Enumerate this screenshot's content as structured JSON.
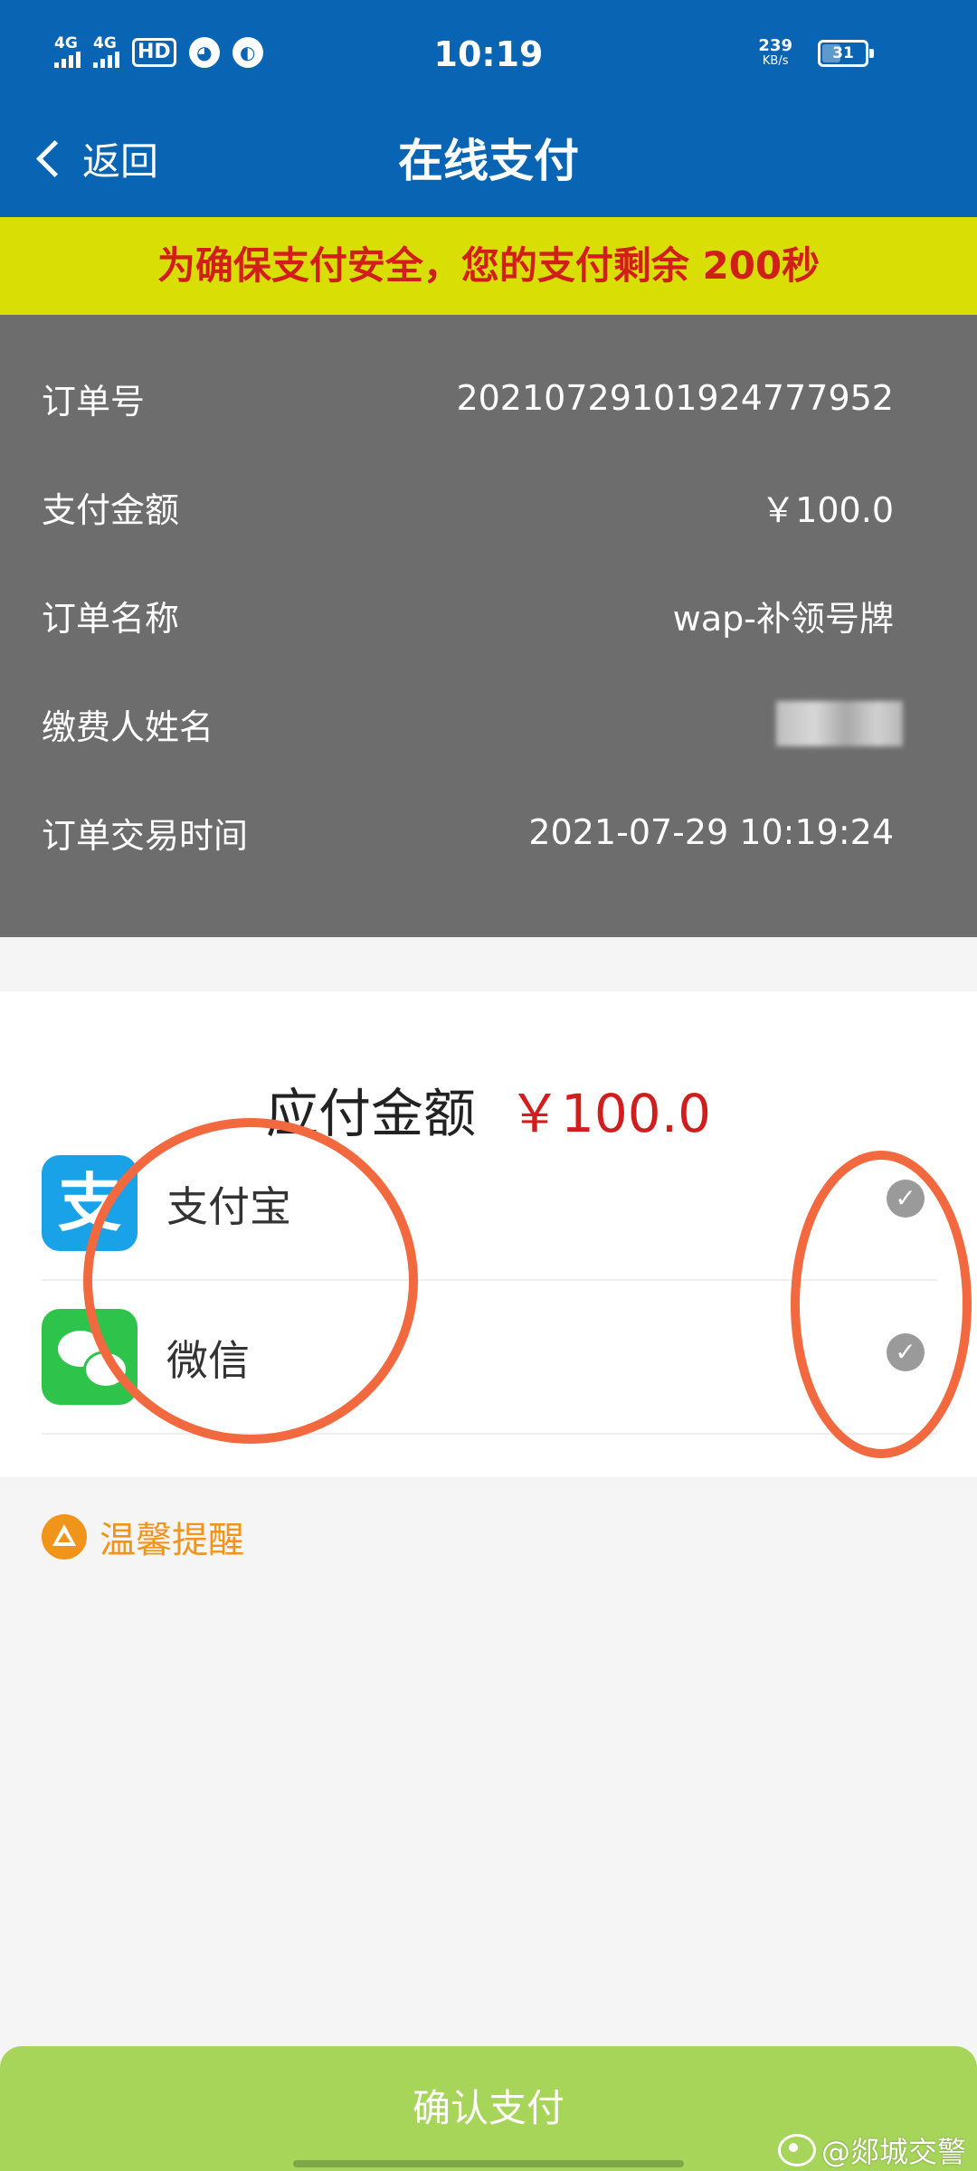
{
  "status_bar": {
    "network1": "4G",
    "network2": "4G",
    "hd": "HD",
    "time": "10:19",
    "speed_value": "239",
    "speed_unit": "KB/s",
    "battery": "31"
  },
  "nav": {
    "back_label": "返回",
    "title": "在线支付"
  },
  "banner": {
    "text": "为确保支付安全，您的支付剩余 ",
    "countdown": "200秒"
  },
  "order": {
    "rows": [
      {
        "label": "订单号",
        "value": "20210729101924777952"
      },
      {
        "label": "支付金额",
        "value": "￥100.0"
      },
      {
        "label": "订单名称",
        "value": "wap-补领号牌"
      },
      {
        "label": "缴费人姓名",
        "value": ""
      },
      {
        "label": "订单交易时间",
        "value": "2021-07-29 10:19:24"
      }
    ]
  },
  "payment": {
    "due_label": "应付金额",
    "due_amount": "￥100.0",
    "methods": [
      {
        "name": "支付宝",
        "icon": "alipay-logo",
        "selected": false
      },
      {
        "name": "微信",
        "icon": "wechat-logo",
        "selected": false
      }
    ]
  },
  "tip": {
    "label": "温馨提醒",
    "icon": "warning-icon"
  },
  "confirm_button": {
    "label": "确认支付"
  },
  "watermark": {
    "text": "@郯城交警"
  },
  "colors": {
    "nav_blue": "#0a64b4",
    "banner_yellow": "#d9df05",
    "banner_red": "#d21e19",
    "order_gray": "#6e6d6d",
    "price_red": "#d01e1e",
    "confirm_green": "#a6d55a",
    "tip_orange": "#f1941a",
    "annotation_orange": "#f2683f"
  }
}
